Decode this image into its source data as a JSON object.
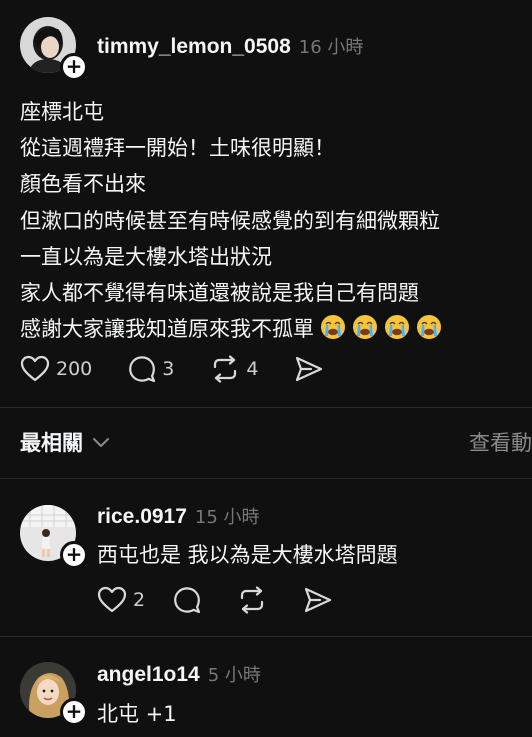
{
  "post": {
    "username": "timmy_lemon_0508",
    "time": "16 小時",
    "lines": [
      "座標北屯",
      "從這週禮拜一開始！土味很明顯！",
      "顏色看不出來",
      "但漱口的時候甚至有時候感覺的到有細微顆粒",
      "一直以為是大樓水塔出狀況",
      "家人都不覺得有味道還被說是我自己有問題",
      "感謝大家讓我知道原來我不孤單"
    ],
    "emojis": [
      "loudly-crying-face",
      "loudly-crying-face",
      "loudly-crying-face",
      "loudly-crying-face"
    ],
    "likes": "200",
    "comments": "3",
    "reposts": "4"
  },
  "sort": {
    "label": "最相關",
    "view_activity": "查看動"
  },
  "replies": [
    {
      "username": "rice.0917",
      "time": "15 小時",
      "text": "西屯也是 我以為是大樓水塔問題",
      "likes": "2"
    },
    {
      "username": "angel1o14",
      "time": "5 小時",
      "text": "北屯 +1"
    }
  ]
}
